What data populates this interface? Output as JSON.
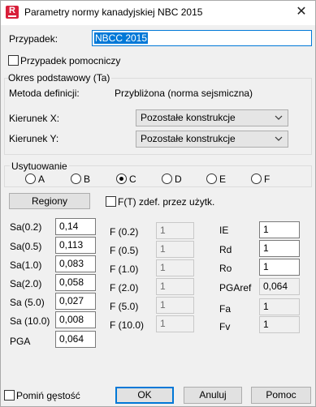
{
  "window": {
    "title": "Parametry normy kanadyjskiej NBC 2015",
    "app_icon_letter": "R",
    "close_glyph": "✕"
  },
  "case": {
    "label": "Przypadek:",
    "value": "NBCC 2015",
    "auxiliary_label": "Przypadek pomocniczy",
    "auxiliary_checked": false
  },
  "period": {
    "group_title": "Okres podstawowy (Ta)",
    "method_label": "Metoda definicji:",
    "method_value": "Przybliżona (norma sejsmiczna)",
    "dir_x_label": "Kierunek X:",
    "dir_x_value": "Pozostałe konstrukcje",
    "dir_y_label": "Kierunek Y:",
    "dir_y_value": "Pozostałe konstrukcje"
  },
  "site": {
    "group_title": "Usytuowanie",
    "options": [
      "A",
      "B",
      "C",
      "D",
      "E",
      "F"
    ],
    "selected": "C"
  },
  "regions_button": "Regiony",
  "ft_user": {
    "label": "F(T) zdef. przez użytk.",
    "checked": false
  },
  "sa": {
    "rows": [
      {
        "label": "Sa(0.2)",
        "value": "0,14"
      },
      {
        "label": "Sa(0.5)",
        "value": "0,113"
      },
      {
        "label": "Sa(1.0)",
        "value": "0,083"
      },
      {
        "label": "Sa(2.0)",
        "value": "0,058"
      },
      {
        "label": "Sa (5.0)",
        "value": "0,027"
      },
      {
        "label": "Sa (10.0)",
        "value": "0,008"
      }
    ],
    "pga_label": "PGA",
    "pga_value": "0,064"
  },
  "f": {
    "rows": [
      {
        "label": "F (0.2)",
        "value": "1"
      },
      {
        "label": "F (0.5)",
        "value": "1"
      },
      {
        "label": "F (1.0)",
        "value": "1"
      },
      {
        "label": "F (2.0)",
        "value": "1"
      },
      {
        "label": "F (5.0)",
        "value": "1"
      },
      {
        "label": "F (10.0)",
        "value": "1"
      }
    ]
  },
  "right_params": {
    "ie_label": "IE",
    "ie_value": "1",
    "rd_label": "Rd",
    "rd_value": "1",
    "ro_label": "Ro",
    "ro_value": "1",
    "pgaref_label": "PGAref",
    "pgaref_value": "0,064",
    "fa_label": "Fa",
    "fa_value": "1",
    "fv_label": "Fv",
    "fv_value": "1"
  },
  "footer": {
    "skip_density_label": "Pomiń gęstość",
    "skip_density_checked": false,
    "ok": "OK",
    "cancel": "Anuluj",
    "help": "Pomoc"
  },
  "colors": {
    "accent": "#0078d7",
    "app_icon": "#d81f3a",
    "dialog_bg": "#f0f0f0"
  },
  "icons": {
    "app": "app-logo-icon",
    "close": "close-icon",
    "combo_arrow": "chevron-down-icon"
  }
}
